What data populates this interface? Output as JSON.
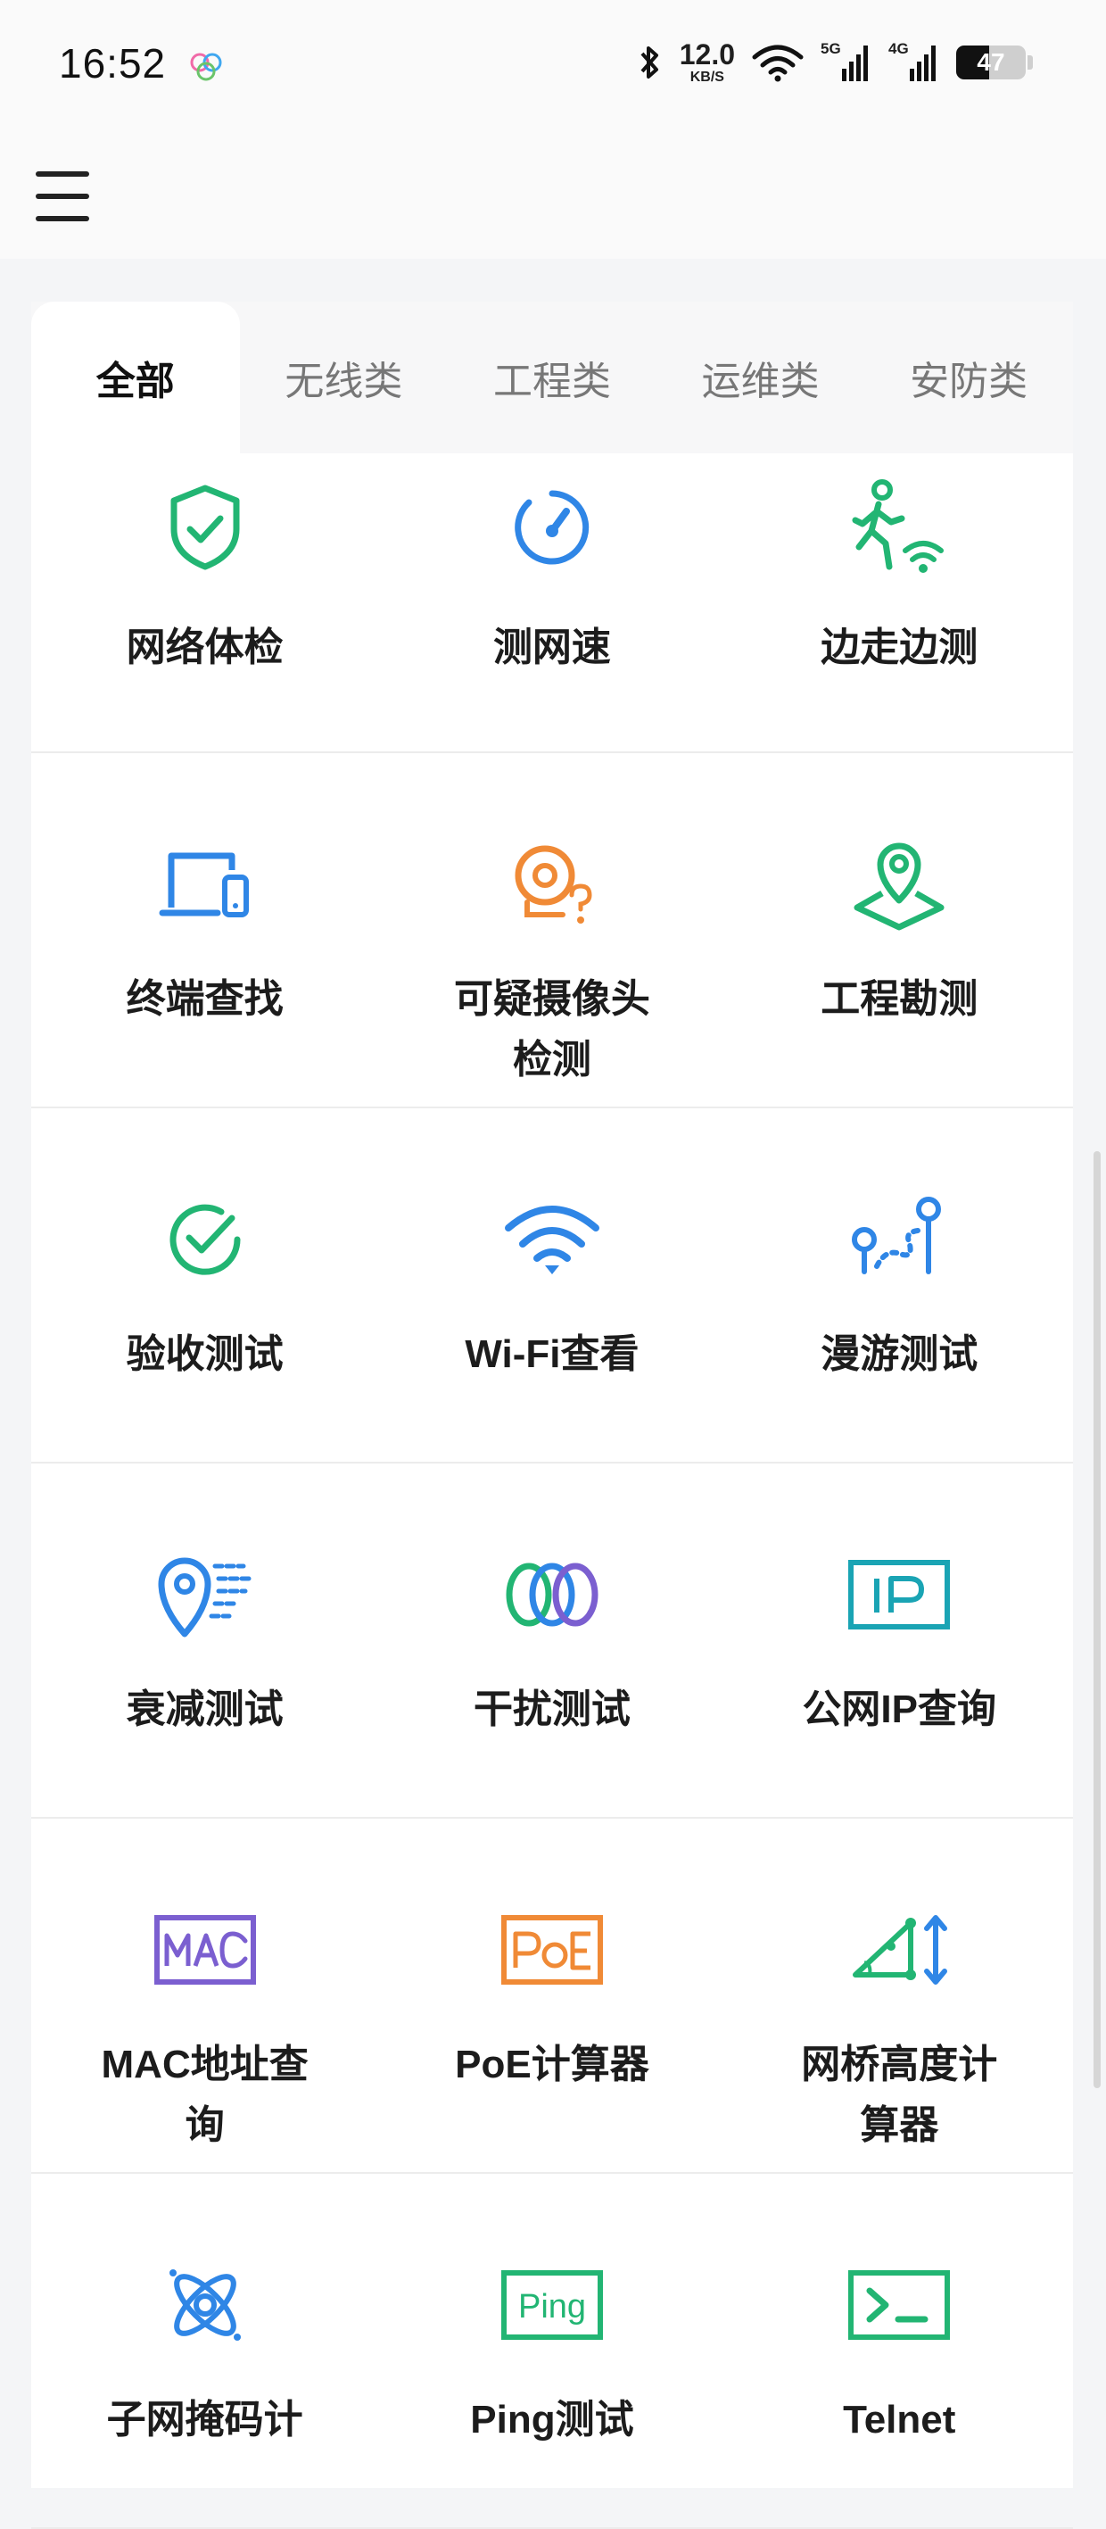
{
  "status_bar": {
    "time": "16:52",
    "net_speed_value": "12.0",
    "net_speed_unit": "KB/S",
    "sim1_label": "5G",
    "sim2_label": "4G",
    "battery": "47",
    "battery_level": 0.47
  },
  "header": {
    "menu_icon": "hamburger-menu-icon"
  },
  "tabs": [
    "全部",
    "无线类",
    "工程类",
    "运维类",
    "安防类"
  ],
  "active_tab": 0,
  "tools": [
    {
      "label": "网络体检",
      "icon": "shield-check-icon",
      "color": "#22b573"
    },
    {
      "label": "测网速",
      "icon": "speedometer-icon",
      "color": "#2f86e6"
    },
    {
      "label": "边走边测",
      "icon": "walking-wifi-icon",
      "color": "#22b573"
    },
    {
      "label": "终端查找",
      "icon": "devices-icon",
      "color": "#2f86e6"
    },
    {
      "label": "可疑摄像头检测",
      "icon": "camera-question-icon",
      "color": "#f08a36"
    },
    {
      "label": "工程勘测",
      "icon": "map-pin-icon",
      "color": "#22b573"
    },
    {
      "label": "验收测试",
      "icon": "check-circle-icon",
      "color": "#22b573"
    },
    {
      "label": "Wi-Fi查看",
      "icon": "wifi-icon",
      "color": "#2f86e6"
    },
    {
      "label": "漫游测试",
      "icon": "roaming-path-icon",
      "color": "#2f86e6"
    },
    {
      "label": "衰减测试",
      "icon": "signal-attenuation-icon",
      "color": "#2f86e6"
    },
    {
      "label": "干扰测试",
      "icon": "interference-rings-icon",
      "color": "#22b573"
    },
    {
      "label": "公网IP查询",
      "icon": "ip-box-icon",
      "color": "#1aa4b4"
    },
    {
      "label": "MAC地址查询",
      "icon": "mac-box-icon",
      "color": "#7b5fd0"
    },
    {
      "label": "PoE计算器",
      "icon": "poe-box-icon",
      "color": "#f08a36"
    },
    {
      "label": "网桥高度计算器",
      "icon": "bridge-height-icon",
      "color": "#22b573"
    },
    {
      "label": "子网掩码计",
      "icon": "subnet-atom-icon",
      "color": "#2f86e6"
    },
    {
      "label": "Ping测试",
      "icon": "ping-box-icon",
      "color": "#22b573"
    },
    {
      "label": "Telnet",
      "icon": "terminal-icon",
      "color": "#22b573"
    }
  ],
  "colors": {
    "green": "#22b573",
    "blue": "#2f86e6",
    "orange": "#f08a36",
    "purple": "#7b5fd0",
    "teal": "#1aa4b4"
  }
}
